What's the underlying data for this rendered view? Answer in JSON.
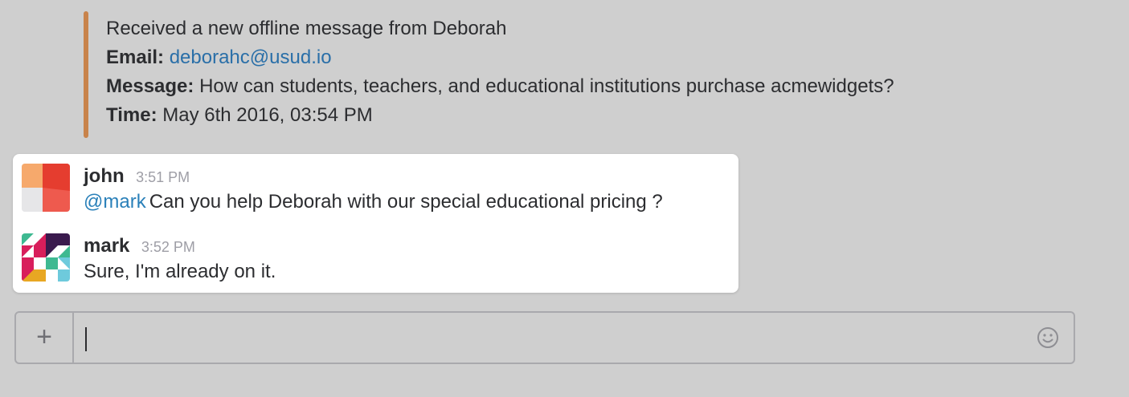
{
  "colors": {
    "accent_bar": "#c8834b",
    "link": "#2a6fa8",
    "mention": "#2a80b9"
  },
  "notification": {
    "intro": "Received a new offline message from Deborah",
    "email_label": "Email:",
    "email_value": "deborahc@usud.io",
    "message_label": "Message:",
    "message_value": "How can students, teachers, and educational institutions purchase acmewidgets?",
    "time_label": "Time:",
    "time_value": "May 6th 2016, 03:54 PM"
  },
  "messages": [
    {
      "username": "john",
      "timestamp": "3:51 PM",
      "mention": "@mark",
      "text": "Can you help Deborah with our special educational pricing ?",
      "avatar_icon": "john-avatar-icon"
    },
    {
      "username": "mark",
      "timestamp": "3:52 PM",
      "mention": "",
      "text": "Sure, I'm already on it.",
      "avatar_icon": "mark-avatar-icon"
    }
  ],
  "composer": {
    "plus_label": "+",
    "input_value": "",
    "emoji_icon": "smiley-icon",
    "attach_icon": "plus-icon"
  }
}
